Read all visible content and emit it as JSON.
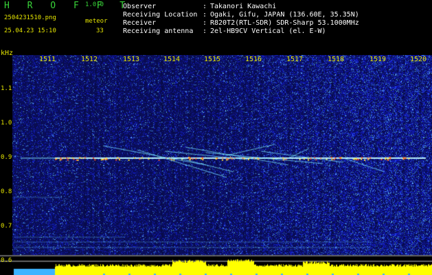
{
  "header": {
    "logo": "H R O F F T",
    "version": "1.0.0",
    "filename": "2504231510.png",
    "datetime": "25.04.23 15:10",
    "meteor_label": "meteor",
    "meteor_count": "33"
  },
  "info": [
    {
      "key": "Observer",
      "value": "Takanori Kawachi"
    },
    {
      "key": "Receiving Location",
      "value": "Ogaki, Gifu, JAPAN (136.60E, 35.35N)"
    },
    {
      "key": "Receiver",
      "value": "R820T2(RTL-SDR) SDR-Sharp 53.1000MHz"
    },
    {
      "key": "Receiving antenna",
      "value": "2el-HB9CV Vertical (el. E-W)"
    }
  ],
  "axes": {
    "y_unit": "kHz",
    "y_labels": [
      "1.1",
      "1.0",
      "0.9",
      "0.8",
      "0.7",
      "0.6"
    ],
    "x_labels": [
      "1511",
      "1512",
      "1513",
      "1514",
      "1515",
      "1516",
      "1517",
      "1518",
      "1519",
      "1520"
    ]
  },
  "colors": {
    "background": "#000000",
    "noise": "#1a24a8",
    "signal": "#5fe0ff",
    "text_green": "#39d439",
    "text_yellow": "#e6e600",
    "bar_yellow": "#ffff00"
  }
}
